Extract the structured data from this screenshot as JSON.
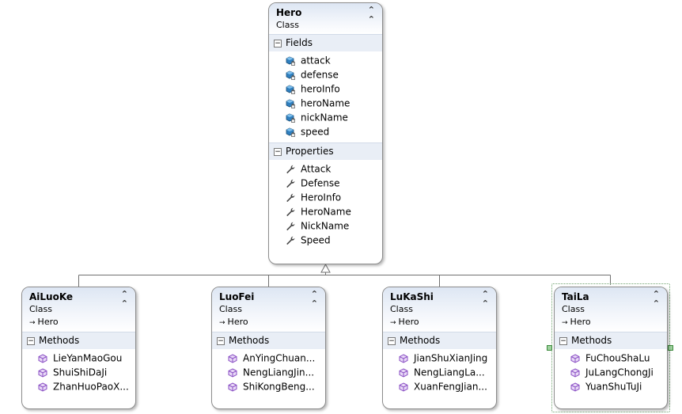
{
  "colors": {
    "class_border": "#8c8c8c",
    "header_gradient": "#dde6f3",
    "section_header": "#e9eef6",
    "field_icon": "#2f7fbf",
    "method_icon": "#8a4fc4",
    "selection": "#3c8a3c"
  },
  "icons": {
    "field": "field-icon",
    "property": "wrench-icon",
    "method": "method-cube-icon",
    "collapse": "double-chevron-up-icon",
    "section_toggle": "minus-box-icon",
    "inherits": "inherit-arrow-icon"
  },
  "hero": {
    "name": "Hero",
    "stereotype": "Class",
    "fields_label": "Fields",
    "fields": [
      "attack",
      "defense",
      "heroInfo",
      "heroName",
      "nickName",
      "speed"
    ],
    "properties_label": "Properties",
    "properties": [
      "Attack",
      "Defense",
      "HeroInfo",
      "HeroName",
      "NickName",
      "Speed"
    ]
  },
  "subclasses": [
    {
      "name": "AiLuoKe",
      "stereotype": "Class",
      "base": "Hero",
      "methods_label": "Methods",
      "methods": [
        "LieYanMaoGou",
        "ShuiShiDaJi",
        "ZhanHuoPaoX..."
      ]
    },
    {
      "name": "LuoFei",
      "stereotype": "Class",
      "base": "Hero",
      "methods_label": "Methods",
      "methods": [
        "AnYingChuan...",
        "NengLiangJin...",
        "ShiKongBeng..."
      ]
    },
    {
      "name": "LuKaShi",
      "stereotype": "Class",
      "base": "Hero",
      "methods_label": "Methods",
      "methods": [
        "JianShuXianJing",
        "NengLiangLa...",
        "XuanFengJian..."
      ]
    },
    {
      "name": "TaiLa",
      "stereotype": "Class",
      "base": "Hero",
      "methods_label": "Methods",
      "methods": [
        "FuChouShaLu",
        "JuLangChongJi",
        "YuanShuTuJi"
      ],
      "selected": true
    }
  ]
}
